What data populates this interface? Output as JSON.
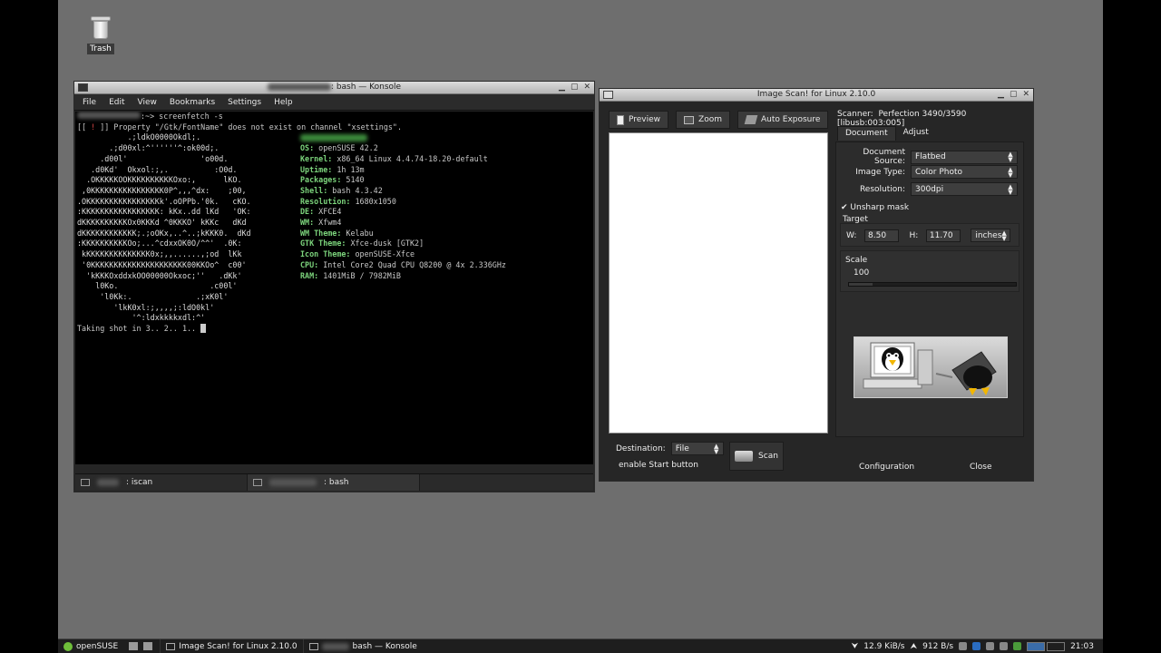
{
  "desktop": {
    "icons": [
      {
        "label": "Trash",
        "icon": "trash-icon"
      }
    ]
  },
  "konsole": {
    "title": ": bash — Konsole",
    "menu": [
      "File",
      "Edit",
      "View",
      "Bookmarks",
      "Settings",
      "Help"
    ],
    "prompt_line": ":~> screenfetch -s",
    "warning_pre": "[[ ",
    "warning_mark": "!",
    "warning_post": " ]] Property \"/Gtk/FontName\" does not exist on channel \"xsettings\".",
    "art": [
      "           .;ldkO0000Okdl;.",
      "       .;d00xl:^''''''^:ok00d;.",
      "     .d00l'                'o00d.",
      "   .d0Kd'  Okxol:;,.          :O0d.",
      "  .OKKKKKOOKKKKKKKKKKOxo:,      lKO.",
      " ,0KKKKKKKKKKKKKKKK0P^,,,^dx:    ;00,",
      ".OKKKKKKKKKKKKKKKKk'.oOPPb.'0k.   cKO.",
      ":KKKKKKKKKKKKKKKKK: kKx..dd lKd   'OK:",
      "dKKKKKKKKKKOx0KKKd ^0KKKO' kKKc   dKd",
      "dKKKKKKKKKKKK;.;oOKx,..^..;kKKK0.  dKd",
      ":KKKKKKKKKKOo;...^cdxxOK0O/^^'  .0K:",
      " kKKKKKKKKKKKKKK0x;,,......,;od  lKk",
      " '0KKKKKKKKKKKKKKKKKKKKK00KKOo^  c00'",
      "  'kKKKOxddxkOO00000Okxoc;''   .dKk'",
      "    l0Ko.                    .c00l'",
      "     'l0Kk:.              .;xK0l'",
      "        'lkK0xl:;,,,,;:ldO0kl'",
      "            '^:ldxkkkkxdl:^'"
    ],
    "info": [
      {
        "k": "OS:",
        "v": " openSUSE 42.2"
      },
      {
        "k": "Kernel:",
        "v": " x86_64 Linux 4.4.74-18.20-default"
      },
      {
        "k": "Uptime:",
        "v": " 1h 13m"
      },
      {
        "k": "Packages:",
        "v": " 5140"
      },
      {
        "k": "Shell:",
        "v": " bash 4.3.42"
      },
      {
        "k": "Resolution:",
        "v": " 1680x1050"
      },
      {
        "k": "DE:",
        "v": " XFCE4"
      },
      {
        "k": "WM:",
        "v": " Xfwm4"
      },
      {
        "k": "WM Theme:",
        "v": " Kelabu"
      },
      {
        "k": "GTK Theme:",
        "v": " Xfce-dusk [GTK2]"
      },
      {
        "k": "Icon Theme:",
        "v": " openSUSE-Xfce"
      },
      {
        "k": "CPU:",
        "v": " Intel Core2 Quad CPU Q8200 @ 4x 2.336GHz"
      },
      {
        "k": "RAM:",
        "v": " 1401MiB / 7982MiB"
      }
    ],
    "last_line": "Taking shot in 3.. 2.. 1.. ",
    "tabs": [
      {
        "label": ": iscan"
      },
      {
        "label": ": bash"
      }
    ]
  },
  "iscan": {
    "title": "Image Scan! for Linux 2.10.0",
    "buttons": {
      "preview": "Preview",
      "zoom": "Zoom",
      "auto_exposure": "Auto Exposure"
    },
    "scanner_label": "Scanner:",
    "scanner_value": "Perfection 3490/3590 [libusb:003:005]",
    "tabs": [
      "Document",
      "Adjust"
    ],
    "doc_source_label": "Document Source:",
    "doc_source_value": "Flatbed",
    "image_type_label": "Image Type:",
    "image_type_value": "Color Photo",
    "resolution_label": "Resolution:",
    "resolution_value": "300dpi",
    "unsharp_label": "Unsharp mask",
    "target_label": "Target",
    "w_label": "W:",
    "w_value": "8.50",
    "h_label": "H:",
    "h_value": "11.70",
    "units_value": "inches",
    "scale_label": "Scale",
    "scale_value": "100",
    "destination_label": "Destination:",
    "destination_value": "File",
    "scan_button": "Scan",
    "enable_start": "enable Start button",
    "config_button": "Configuration",
    "close_button": "Close"
  },
  "taskbar": {
    "start_label": "openSUSE",
    "windows": [
      {
        "label": "Image Scan! for Linux 2.10.0"
      },
      {
        "label": "bash — Konsole"
      }
    ],
    "net_down": "12.9 KiB/s",
    "net_up": "912 B/s",
    "clock": "21:03"
  }
}
